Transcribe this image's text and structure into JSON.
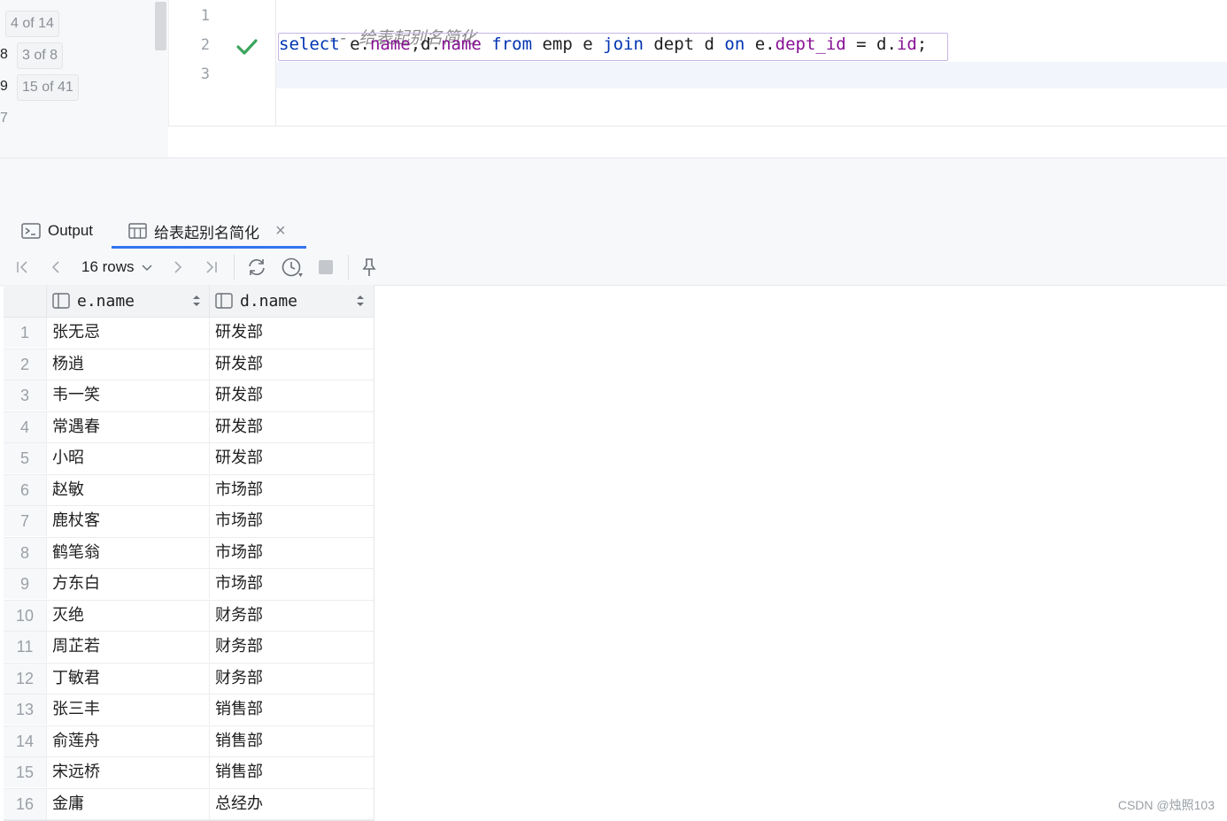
{
  "history": [
    {
      "num": "",
      "badge": "4 of 14"
    },
    {
      "num": "8",
      "badge": "3 of 8"
    },
    {
      "num": "9",
      "badge": "15 of 41"
    },
    {
      "num": "7",
      "badge": ""
    }
  ],
  "editor": {
    "line_numbers": [
      "1",
      "2",
      "3"
    ],
    "comment": "-- 给表起别名简化",
    "sql": {
      "select": "select",
      "e1": " e.",
      "name1": "name",
      "c1": ",d.",
      "name2": "name",
      "sp1": " ",
      "from": "from",
      "emp": " emp e ",
      "join": "join",
      "dept": " dept d ",
      "on": "on",
      "e2": " e.",
      "dept_id": "dept_id",
      "eq": " = d.",
      "id": "id",
      "semi": ";"
    }
  },
  "tabs": {
    "output_label": "Output",
    "result_label": "给表起别名简化",
    "close_glyph": "×"
  },
  "toolbar": {
    "rows_label": "16 rows"
  },
  "grid": {
    "columns": [
      "e.name",
      "d.name"
    ],
    "rows": [
      [
        "1",
        "张无忌",
        "研发部"
      ],
      [
        "2",
        "杨逍",
        "研发部"
      ],
      [
        "3",
        "韦一笑",
        "研发部"
      ],
      [
        "4",
        "常遇春",
        "研发部"
      ],
      [
        "5",
        "小昭",
        "研发部"
      ],
      [
        "6",
        "赵敏",
        "市场部"
      ],
      [
        "7",
        "鹿杖客",
        "市场部"
      ],
      [
        "8",
        "鹤笔翁",
        "市场部"
      ],
      [
        "9",
        "方东白",
        "市场部"
      ],
      [
        "10",
        "灭绝",
        "财务部"
      ],
      [
        "11",
        "周芷若",
        "财务部"
      ],
      [
        "12",
        "丁敏君",
        "财务部"
      ],
      [
        "13",
        "张三丰",
        "销售部"
      ],
      [
        "14",
        "俞莲舟",
        "销售部"
      ],
      [
        "15",
        "宋远桥",
        "销售部"
      ],
      [
        "16",
        "金庸",
        "总经办"
      ]
    ]
  },
  "watermark": "CSDN @烛照103",
  "colors": {
    "accent": "#3574f0",
    "keyword": "#0033b3",
    "field": "#871094",
    "check": "#3ba55c"
  }
}
